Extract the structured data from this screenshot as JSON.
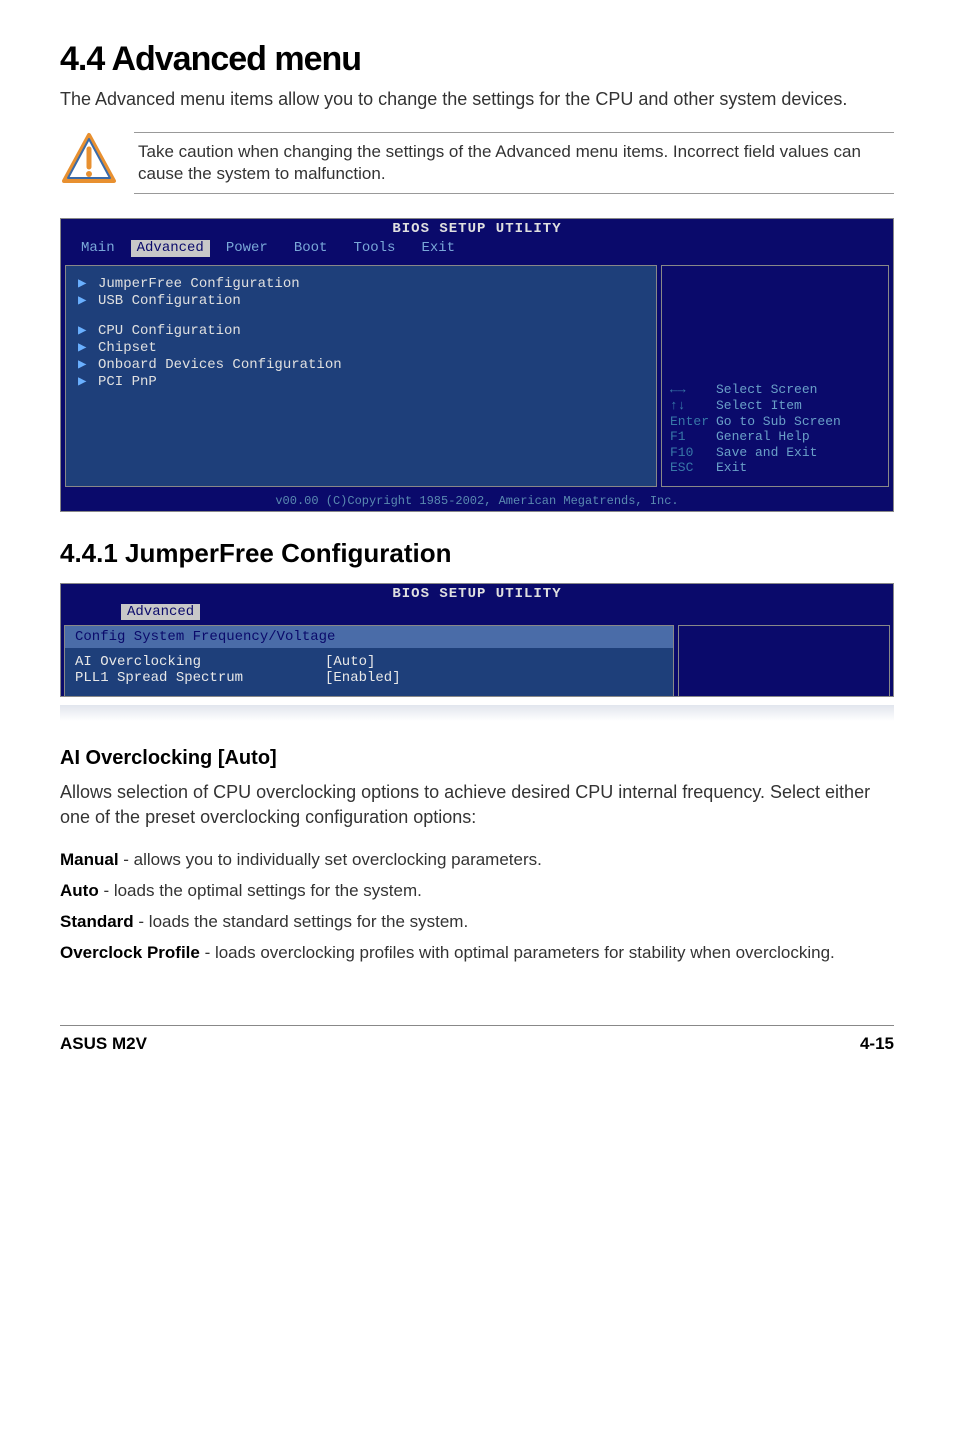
{
  "heading_main": "4.4    Advanced menu",
  "intro": "The Advanced menu items allow you to change the settings for the CPU and other system devices.",
  "caution": "Take caution when changing the settings of the Advanced menu items. Incorrect field values can cause the system to malfunction.",
  "bios1": {
    "title": "BIOS SETUP UTILITY",
    "tabs": {
      "main": "Main",
      "advanced": "Advanced",
      "power": "Power",
      "boot": "Boot",
      "tools": "Tools",
      "exit": "Exit"
    },
    "items": {
      "i0": "JumperFree Configuration",
      "i1": "USB Configuration",
      "i2": "CPU Configuration",
      "i3": "Chipset",
      "i4": "Onboard Devices Configuration",
      "i5": "PCI PnP"
    },
    "help": {
      "r0k": "←→",
      "r0v": "Select Screen",
      "r1k": "↑↓",
      "r1v": "Select Item",
      "r2k": "Enter",
      "r2v": "Go to Sub Screen",
      "r3k": "F1",
      "r3v": "General Help",
      "r4k": "F10",
      "r4v": "Save and Exit",
      "r5k": "ESC",
      "r5v": "Exit"
    },
    "footer": "v00.00 (C)Copyright 1985-2002, American Megatrends, Inc."
  },
  "heading_sub": "4.4.1   JumperFree Configuration",
  "bios2": {
    "title": "BIOS SETUP UTILITY",
    "tab": "Advanced",
    "panel_header": "Config System Frequency/Voltage",
    "rows": {
      "r0l": "AI Overclocking",
      "r0v": "[Auto]",
      "r1l": "PLL1 Spread Spectrum",
      "r1v": "[Enabled]"
    }
  },
  "chart_data": {
    "type": "table",
    "title": "Config System Frequency/Voltage",
    "rows": [
      {
        "option": "AI Overclocking",
        "value": "Auto"
      },
      {
        "option": "PLL1 Spread Spectrum",
        "value": "Enabled"
      }
    ]
  },
  "section_h3": "AI Overclocking [Auto]",
  "section_body": "Allows selection of CPU overclocking options to achieve desired CPU internal frequency. Select either one of the preset overclocking configuration options:",
  "opts": {
    "manual_b": "Manual",
    "manual_t": " - allows you to individually set overclocking parameters.",
    "auto_b": "Auto",
    "auto_t": " - loads the optimal settings for the system.",
    "std_b": "Standard",
    "std_t": " - loads the standard settings for the system.",
    "oc_b": "Overclock Profile",
    "oc_t": " - loads overclocking profiles with optimal parameters for stability when overclocking."
  },
  "footer": {
    "left": "ASUS M2V",
    "right": "4-15"
  }
}
